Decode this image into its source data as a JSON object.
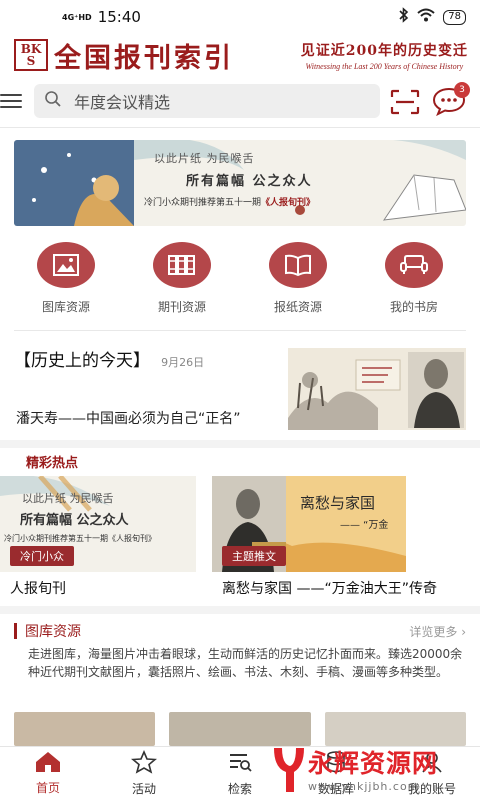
{
  "status": {
    "network": "4G⁺HD",
    "time": "15:40",
    "battery": "78"
  },
  "brand": {
    "logo_mark_top": "BK",
    "logo_mark_bottom": "S",
    "title": "全国报刊索引",
    "slogan_cn": "见证近200年的历史变迁",
    "slogan_en": "Witnessing the Last 200 Years of Chinese History"
  },
  "search": {
    "placeholder": "年度会议精选",
    "message_count": "3"
  },
  "banner": {
    "line1": "以此片纸  为民喉舌",
    "line2": "所有篇幅  公之众人",
    "line3_prefix": "冷门小众期刊推荐第五十一期",
    "line3_title": "《人报旬刊》"
  },
  "quick": [
    {
      "label": "图库资源",
      "icon": "image-icon"
    },
    {
      "label": "期刊资源",
      "icon": "periodicals-icon"
    },
    {
      "label": "报纸资源",
      "icon": "open-book-icon"
    },
    {
      "label": "我的书房",
      "icon": "sofa-icon"
    }
  ],
  "today": {
    "title": "【历史上的今天】",
    "date": "9月26日",
    "headline": "潘天寿——中国画必须为自己“正名”"
  },
  "hot": {
    "title": "精彩热点",
    "cards": [
      {
        "tag": "冷门小众",
        "caption": "人报旬刊"
      },
      {
        "tag": "主题推文",
        "caption": "离愁与家国 ——“万金油大王”传奇",
        "img_title": "离愁与家国",
        "img_sub": "—— “万金"
      }
    ]
  },
  "library": {
    "title": "图库资源",
    "more": "详览更多",
    "desc": "走进图库，海量图片冲击着眼球，生动而鲜活的历史记忆扑面而来。臻选20000余种近代期刊文献图片，囊括照片、绘画、书法、木刻、手稿、漫画等多种类型。"
  },
  "tabs": [
    {
      "label": "首页",
      "icon": "home-icon",
      "active": true
    },
    {
      "label": "活动",
      "icon": "star-icon",
      "active": false
    },
    {
      "label": "检索",
      "icon": "search-list-icon",
      "active": false
    },
    {
      "label": "数据库",
      "icon": "database-icon",
      "active": false
    },
    {
      "label": "我的账号",
      "icon": "user-icon",
      "active": false
    }
  ],
  "watermark": {
    "text": "永辉资源网",
    "url": "www.yhkjjbh.com"
  },
  "colors": {
    "brand_red": "#9a1c1c",
    "icon_circle": "#b4474a",
    "tag_red": "#9a2b2e"
  }
}
